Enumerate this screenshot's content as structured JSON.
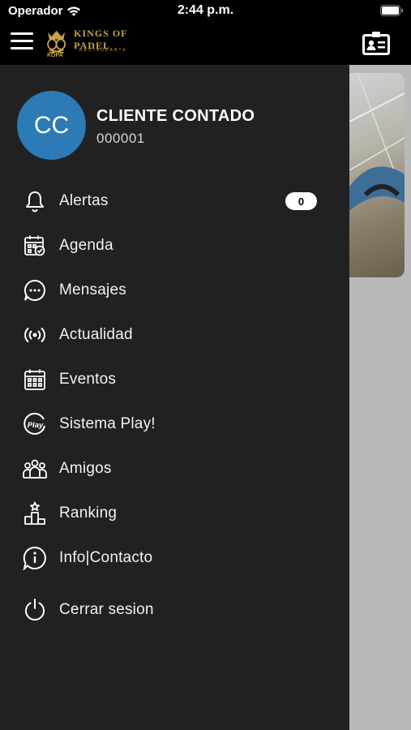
{
  "status_bar": {
    "carrier": "Operador",
    "time": "2:44 p.m."
  },
  "header": {
    "logo_text": "KINGS OF PADEL",
    "logo_sub": "RESTAURANTE",
    "logo_abbr": "KOPA",
    "logo_icon": "crown-rackets-logo",
    "menu_icon": "hamburger-icon",
    "card_icon": "contact-card-icon"
  },
  "user": {
    "initials": "CC",
    "name": "CLIENTE CONTADO",
    "id": "000001",
    "avatar_color": "#2c7ab6"
  },
  "menu": {
    "items": [
      {
        "label": "Alertas",
        "icon": "bell-icon",
        "badge": "0"
      },
      {
        "label": "Agenda",
        "icon": "calendar-check-icon"
      },
      {
        "label": "Mensajes",
        "icon": "chat-bubble-icon"
      },
      {
        "label": "Actualidad",
        "icon": "broadcast-icon"
      },
      {
        "label": "Eventos",
        "icon": "calendar-grid-icon"
      },
      {
        "label": "Sistema Play!",
        "icon": "play-logo-icon"
      },
      {
        "label": "Amigos",
        "icon": "friends-icon"
      },
      {
        "label": "Ranking",
        "icon": "podium-icon"
      },
      {
        "label": "Info|Contacto",
        "icon": "info-bubble-icon"
      },
      {
        "label": "Cerrar sesion",
        "icon": "power-icon"
      }
    ]
  },
  "colors": {
    "drawer_bg": "#212121",
    "accent_gold": "#c9a24a",
    "badge_bg": "#ffffff"
  }
}
